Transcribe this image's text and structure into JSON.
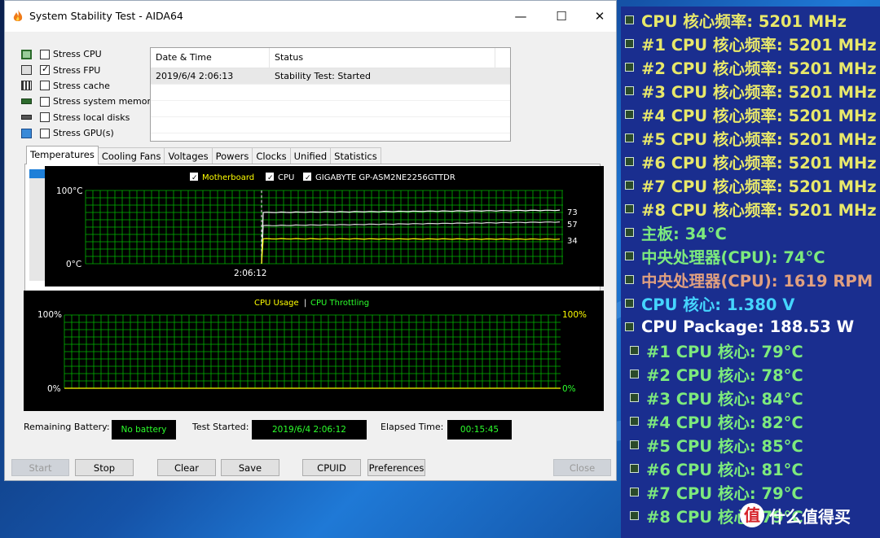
{
  "window": {
    "title": "System Stability Test - AIDA64",
    "controls": [
      "—",
      "☐",
      "✕"
    ]
  },
  "stress": [
    {
      "label": "Stress CPU",
      "checked": false
    },
    {
      "label": "Stress FPU",
      "checked": true
    },
    {
      "label": "Stress cache",
      "checked": false
    },
    {
      "label": "Stress system memory",
      "checked": false
    },
    {
      "label": "Stress local disks",
      "checked": false
    },
    {
      "label": "Stress GPU(s)",
      "checked": false
    }
  ],
  "log": {
    "headers": [
      "Date & Time",
      "Status"
    ],
    "rows": [
      [
        "2019/6/4 2:06:13",
        "Stability Test: Started"
      ]
    ]
  },
  "tabs": [
    "Temperatures",
    "Cooling Fans",
    "Voltages",
    "Powers",
    "Clocks",
    "Unified",
    "Statistics"
  ],
  "temp_graph": {
    "legend": [
      {
        "label": "Motherboard",
        "color": "#ffff00"
      },
      {
        "label": "CPU",
        "color": "#ffffff"
      },
      {
        "label": "GIGABYTE GP-ASM2NE2256GTTDR",
        "color": "#ffffff"
      }
    ],
    "y_top": "100°C",
    "y_bottom": "0°C",
    "x_label": "2:06:12",
    "values": [
      "73",
      "57",
      "34"
    ],
    "grid_color": "#00b400"
  },
  "usage_graph": {
    "legend_a": "CPU Usage",
    "legend_sep": "|",
    "legend_b": "CPU Throttling",
    "left_top": "100%",
    "left_bottom": "0%",
    "right_top": "100%",
    "right_bottom": "0%"
  },
  "status": {
    "battery_label": "Remaining Battery:",
    "battery_value": "No battery",
    "started_label": "Test Started:",
    "started_value": "2019/6/4 2:06:12",
    "elapsed_label": "Elapsed Time:",
    "elapsed_value": "00:15:45"
  },
  "buttons": {
    "start": "Start",
    "stop": "Stop",
    "clear": "Clear",
    "save": "Save",
    "cpuid": "CPUID",
    "preferences": "Preferences",
    "close": "Close"
  },
  "osd": [
    {
      "text": "CPU 核心频率: 5201 MHz",
      "color": "#e8e86a",
      "indent": false
    },
    {
      "text": "#1 CPU 核心频率: 5201 MHz",
      "color": "#e8e86a",
      "indent": false
    },
    {
      "text": "#2 CPU 核心频率: 5201 MHz",
      "color": "#e8e86a",
      "indent": false
    },
    {
      "text": "#3 CPU 核心频率: 5201 MHz",
      "color": "#e8e86a",
      "indent": false
    },
    {
      "text": "#4 CPU 核心频率: 5201 MHz",
      "color": "#e8e86a",
      "indent": false
    },
    {
      "text": "#5 CPU 核心频率: 5201 MHz",
      "color": "#e8e86a",
      "indent": false
    },
    {
      "text": "#6 CPU 核心频率: 5201 MHz",
      "color": "#e8e86a",
      "indent": false
    },
    {
      "text": "#7 CPU 核心频率: 5201 MHz",
      "color": "#e8e86a",
      "indent": false
    },
    {
      "text": "#8 CPU 核心频率: 5201 MHz",
      "color": "#e8e86a",
      "indent": false
    },
    {
      "text": "主板: 34°C",
      "color": "#7dea7d",
      "indent": false
    },
    {
      "text": "中央处理器(CPU): 74°C",
      "color": "#7dea7d",
      "indent": false
    },
    {
      "text": "中央处理器(CPU): 1619 RPM",
      "color": "#e0a080",
      "indent": false
    },
    {
      "text": "CPU 核心: 1.380 V",
      "color": "#45d5ff",
      "indent": false
    },
    {
      "text": "CPU Package: 188.53 W",
      "color": "#ffffff",
      "indent": false
    },
    {
      "text": "#1 CPU 核心: 79°C",
      "color": "#7dea7d",
      "indent": true
    },
    {
      "text": "#2 CPU 核心: 78°C",
      "color": "#7dea7d",
      "indent": true
    },
    {
      "text": "#3 CPU 核心: 84°C",
      "color": "#7dea7d",
      "indent": true
    },
    {
      "text": "#4 CPU 核心: 82°C",
      "color": "#7dea7d",
      "indent": true
    },
    {
      "text": "#5 CPU 核心: 85°C",
      "color": "#7dea7d",
      "indent": true
    },
    {
      "text": "#6 CPU 核心: 81°C",
      "color": "#7dea7d",
      "indent": true
    },
    {
      "text": "#7 CPU 核心: 79°C",
      "color": "#7dea7d",
      "indent": true
    },
    {
      "text": "#8 CPU 核心: 79°C",
      "color": "#7dea7d",
      "indent": true
    }
  ],
  "watermark": {
    "badge": "值",
    "text": "什么值得买"
  }
}
